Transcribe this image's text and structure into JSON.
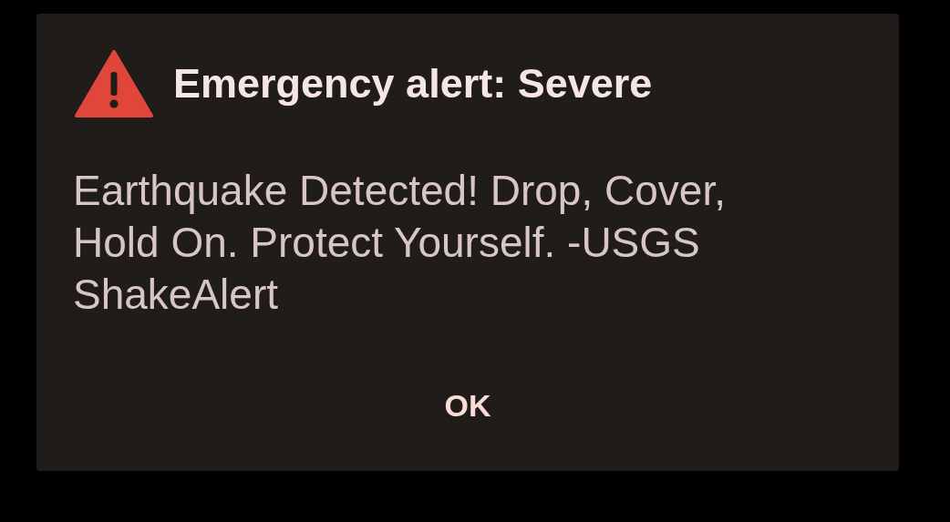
{
  "dialog": {
    "title": "Emergency alert: Severe",
    "message": "Earthquake Detected! Drop, Cover, Hold On. Protect Yourself. -USGS ShakeAlert",
    "buttons": [
      "OK"
    ]
  }
}
